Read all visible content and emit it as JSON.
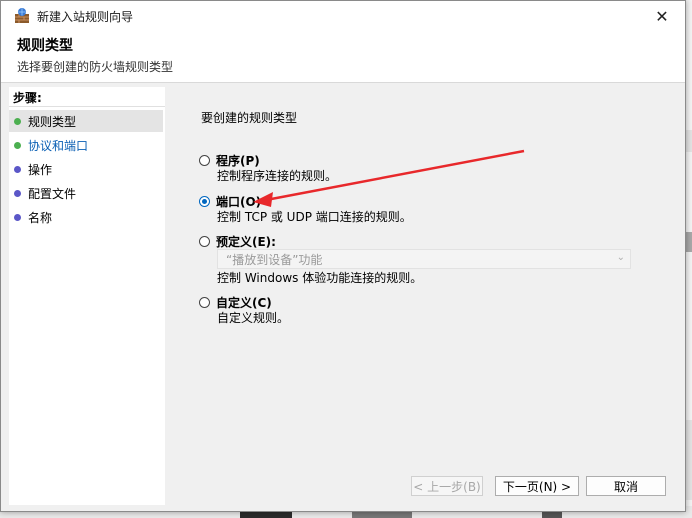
{
  "window": {
    "title": "新建入站规则向导",
    "close_glyph": "✕"
  },
  "header": {
    "title": "规则类型",
    "subtitle": "选择要创建的防火墙规则类型"
  },
  "sidebar": {
    "label": "步骤:",
    "items": [
      {
        "label": "规则类型",
        "dot_color": "#4caf50"
      },
      {
        "label": "协议和端口",
        "dot_color": "#4caf50"
      },
      {
        "label": "操作",
        "dot_color": "#5b57c8"
      },
      {
        "label": "配置文件",
        "dot_color": "#5b57c8"
      },
      {
        "label": "名称",
        "dot_color": "#5b57c8"
      }
    ]
  },
  "main": {
    "prompt": "要创建的规则类型",
    "options": [
      {
        "label": "程序(P)",
        "description": "控制程序连接的规则。",
        "checked": false
      },
      {
        "label": "端口(O)",
        "description": "控制 TCP 或 UDP 端口连接的规则。",
        "checked": true
      },
      {
        "label": "预定义(E):",
        "description": "控制 Windows 体验功能连接的规则。",
        "checked": false
      },
      {
        "label": "自定义(C)",
        "description": "自定义规则。",
        "checked": false
      }
    ],
    "predefined_select": "“播放到设备”功能"
  },
  "buttons": {
    "back": "< 上一步(B)",
    "next": "下一页(N) >",
    "cancel": "取消"
  },
  "colors": {
    "accent": "#0067c0",
    "annotation_arrow": "#e8282b",
    "link": "#0a5fb4"
  }
}
